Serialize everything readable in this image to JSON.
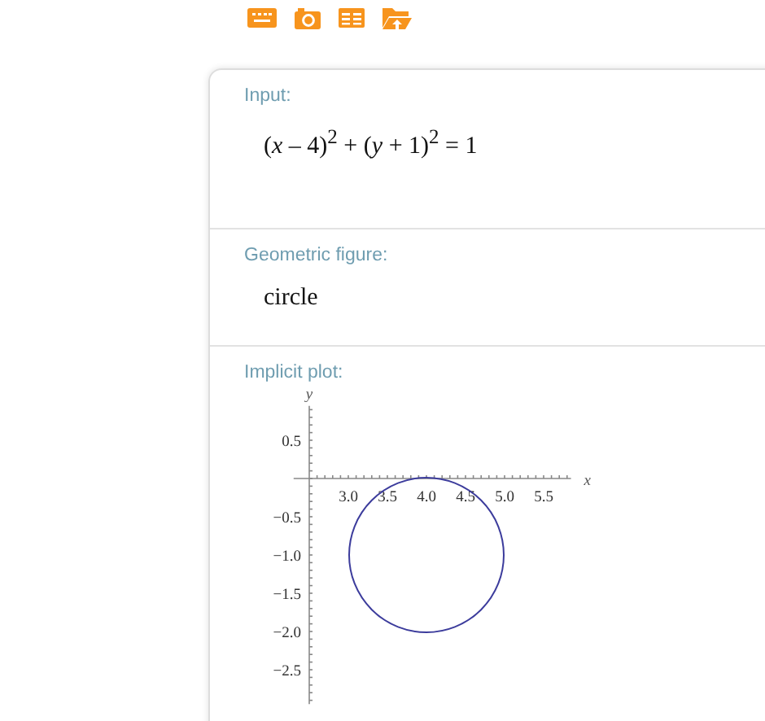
{
  "toolbar": {
    "icons": [
      {
        "kind": "keyboard"
      },
      {
        "kind": "camera"
      },
      {
        "kind": "table"
      },
      {
        "kind": "folder"
      }
    ]
  },
  "pods": [
    {
      "kind": "formula",
      "title": "Input:",
      "content": "(*x* – 4)$^{2}$ + (*y* + 1)$^{2}$ = 1"
    },
    {
      "kind": "text",
      "title": "Geometric figure:",
      "content": "circle"
    },
    {
      "kind": "plot",
      "title": "Implicit plot:",
      "chart_data": {
        "type": "line",
        "xlabel": "x",
        "ylabel": "y",
        "xlim": [
          2.3,
          5.85
        ],
        "ylim": [
          -2.95,
          0.95
        ],
        "xticks": [
          {
            "value": 3,
            "label": "3.0"
          },
          {
            "value": 3.5,
            "label": "3.5"
          },
          {
            "value": 4,
            "label": "4.0"
          },
          {
            "value": 4.5,
            "label": "4.5"
          },
          {
            "value": 5,
            "label": "5.0"
          },
          {
            "value": 5.5,
            "label": "5.5"
          }
        ],
        "yticks": [
          {
            "value": 0.5,
            "label": "0.5"
          },
          {
            "value": -0.5,
            "label": "−0.5"
          },
          {
            "value": -1,
            "label": "−1.0"
          },
          {
            "value": -1.5,
            "label": "−1.5"
          },
          {
            "value": -2,
            "label": "−2.0"
          },
          {
            "value": -2.5,
            "label": "−2.5"
          }
        ]
      }
    }
  ]
}
